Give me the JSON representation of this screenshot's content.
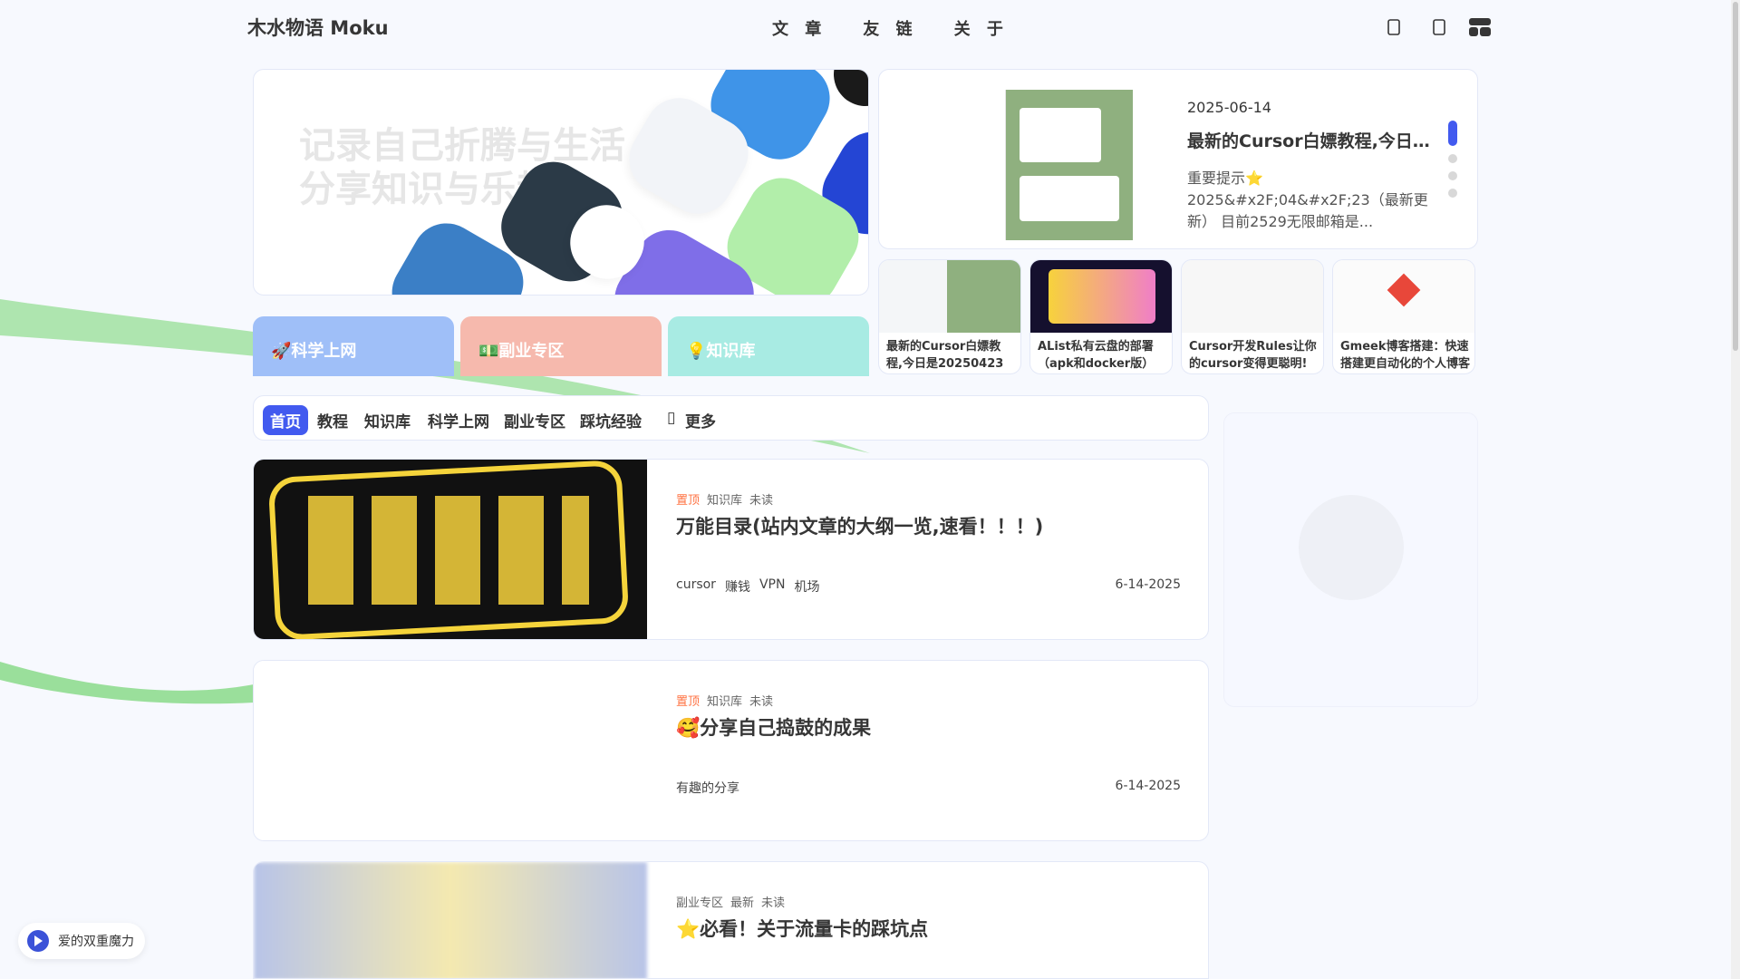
{
  "header": {
    "site_title": "木水物语 Moku",
    "nav": [
      "文 章",
      "友 链",
      "关 于"
    ]
  },
  "banner": {
    "text_line1": "记录自己折腾与生活",
    "text_line2": "分享知识与乐趣"
  },
  "hot": {
    "date": "2025-06-14",
    "title": "最新的Cursor白嫖教程,今日是...",
    "desc": "重要提示⭐ 2025&#x2F;04&#x2F;23（最新更新） 目前2529无限邮箱是..."
  },
  "small_cards": [
    {
      "title": "最新的Cursor白嫖教程,今日是20250423"
    },
    {
      "title": "AList私有云盘的部署（apk和docker版）"
    },
    {
      "title": "Cursor开发Rules让你的cursor变得更聪明!"
    },
    {
      "title": "Gmeek博客搭建：快速搭建更自动化的个人博客"
    }
  ],
  "categories": [
    {
      "label": "🚀科学上网",
      "color": "#9fbff8"
    },
    {
      "label": "💵副业专区",
      "color": "#f6b9ad"
    },
    {
      "label": "💡知识库",
      "color": "#a8ebe3"
    }
  ],
  "tabs": {
    "items": [
      "首页",
      "教程",
      "知识库",
      "科学上网",
      "副业专区",
      "踩坑经验"
    ],
    "more": "更多"
  },
  "posts": [
    {
      "sticky": "置顶",
      "category": "知识库",
      "status": "未读",
      "title": "万能目录(站内文章的大纲一览,速看！！！)",
      "tags": [
        "cursor",
        "赚钱",
        "VPN",
        "机场"
      ],
      "date": "6-14-2025"
    },
    {
      "sticky": "置顶",
      "category": "知识库",
      "status": "未读",
      "title": "🥰分享自己捣鼓的成果",
      "tags": [
        "有趣的分享"
      ],
      "date": "6-14-2025"
    },
    {
      "category": "副业专区",
      "badge": "最新",
      "status": "未读",
      "title": "⭐必看！关于流量卡的踩坑点"
    }
  ],
  "music": {
    "label": "爱的双重魔力"
  },
  "colors": {
    "accent": "#425aef",
    "sticky": "#ff7242"
  }
}
